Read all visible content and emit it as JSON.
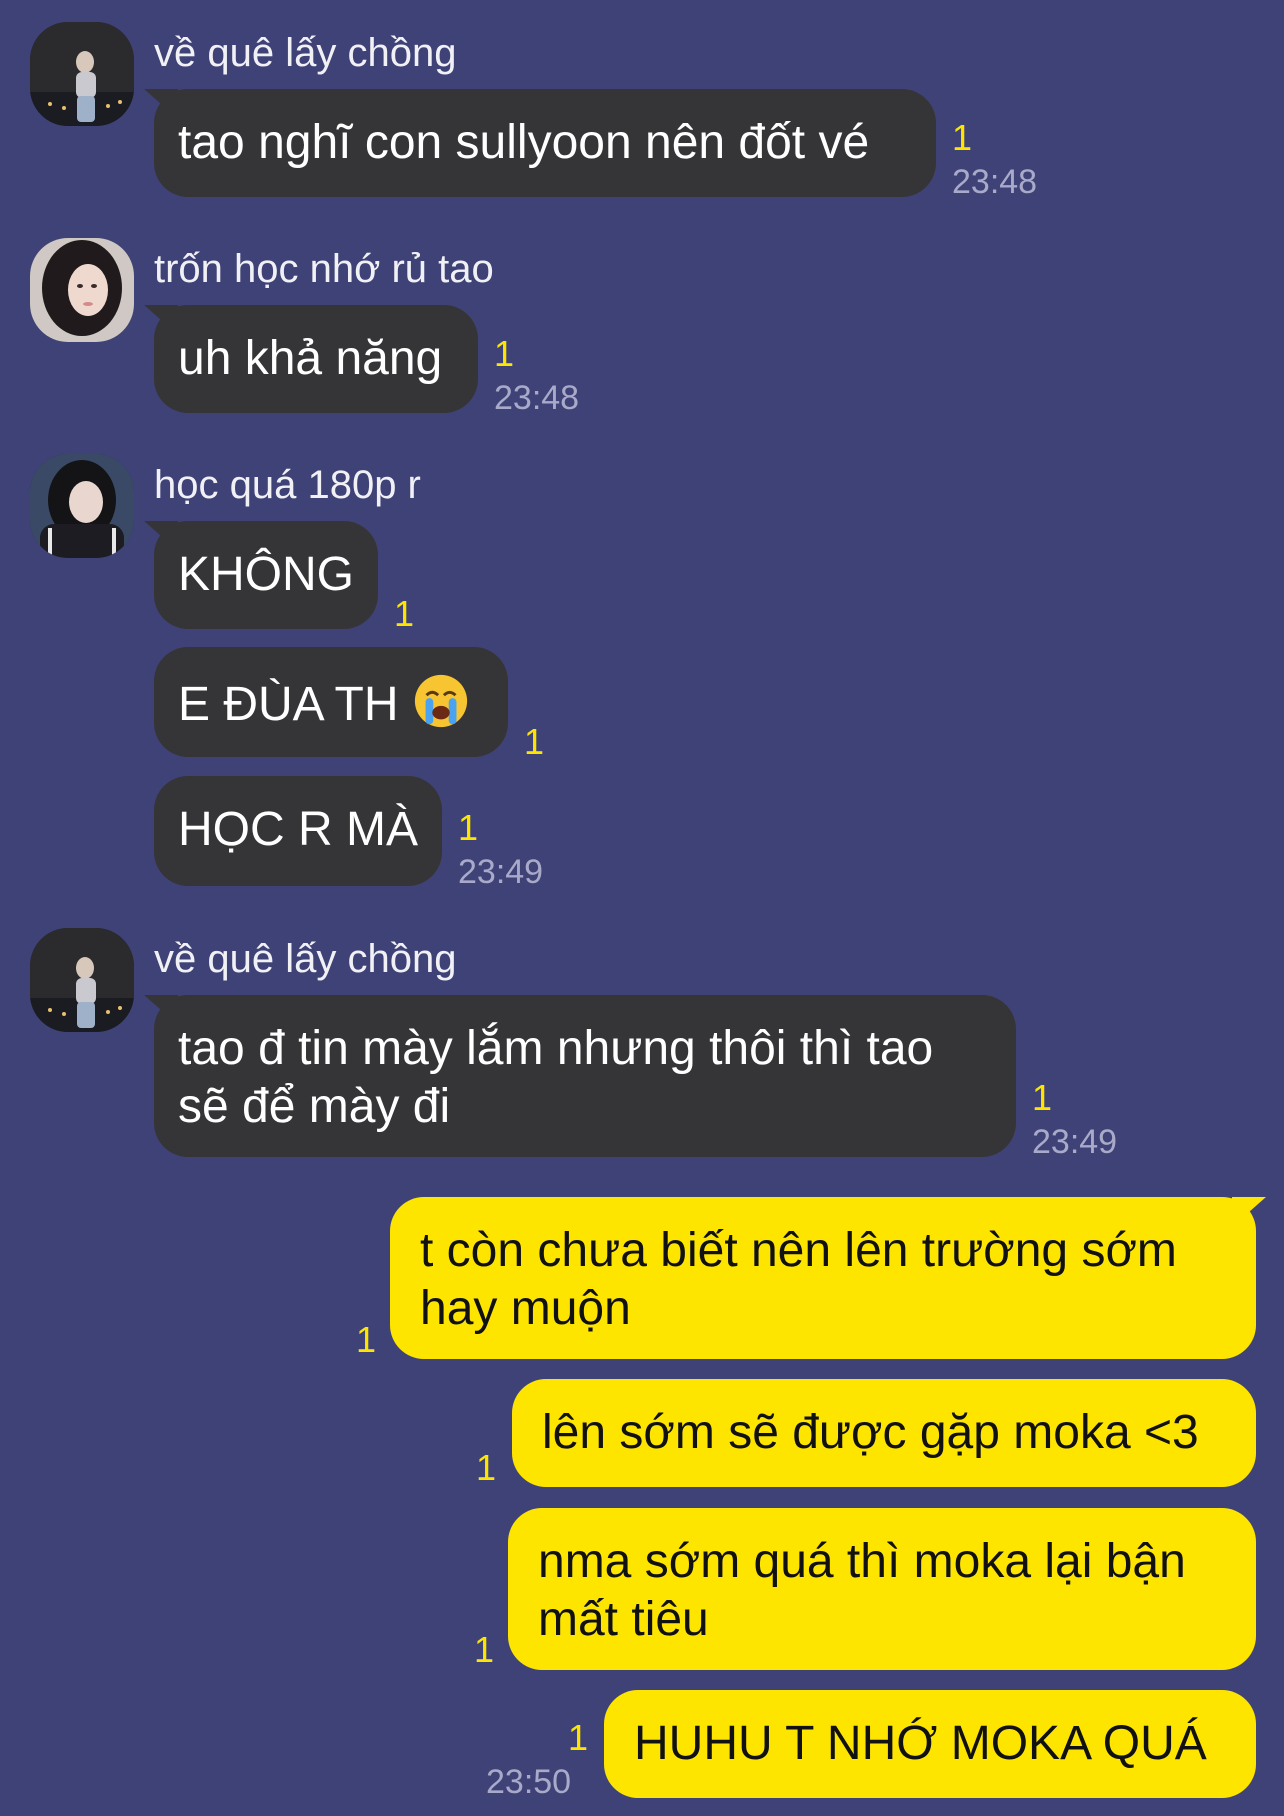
{
  "colors": {
    "background": "#3f4277",
    "incoming_bubble": "#353538",
    "outgoing_bubble": "#fee500",
    "unread": "#fee500",
    "time": "#a9aac9"
  },
  "messages": {
    "g1": {
      "sender": "về quê lấy chồng",
      "text": "tao nghĩ con sullyoon nên đốt vé",
      "unread": "1",
      "time": "23:48"
    },
    "g2": {
      "sender": "trốn học nhớ rủ tao",
      "text": "uh khả năng",
      "unread": "1",
      "time": "23:48"
    },
    "g3": {
      "sender": "học quá 180p r",
      "m1": {
        "text": "KHÔNG",
        "unread": "1"
      },
      "m2": {
        "text": "E ĐÙA TH",
        "emoji": "loudly-crying-face-icon",
        "unread": "1"
      },
      "m3": {
        "text": "HỌC R MÀ",
        "unread": "1",
        "time": "23:49"
      }
    },
    "g4": {
      "sender": "về quê lấy chồng",
      "line1": "tao đ tin mày lắm nhưng thôi thì tao",
      "line2": "sẽ để mày đi",
      "unread": "1",
      "time": "23:49"
    },
    "me": {
      "m1": {
        "line1": "t còn chưa biết nên lên trường sớm",
        "line2": "hay muộn",
        "unread": "1"
      },
      "m2": {
        "text": "lên sớm sẽ được gặp moka <3",
        "unread": "1"
      },
      "m3": {
        "line1": "nma sớm quá thì moka lại bận",
        "line2": "mất tiêu",
        "unread": "1"
      },
      "m4": {
        "text": "HUHU T NHỚ MOKA QUÁ",
        "unread": "1",
        "time": "23:50"
      }
    }
  }
}
